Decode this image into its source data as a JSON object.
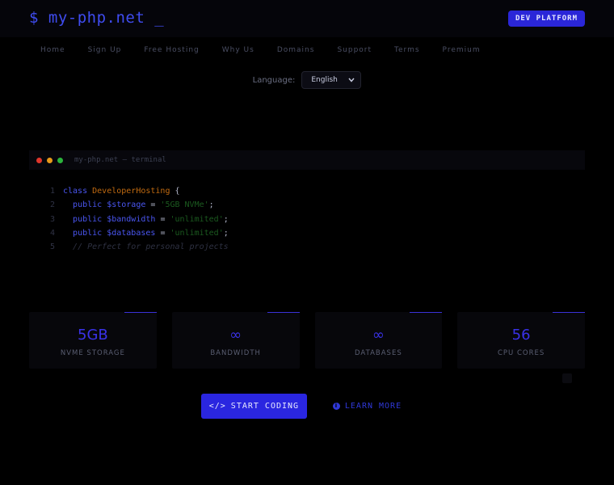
{
  "header": {
    "logo": "$ my-php.net _",
    "badge": "DEV PLATFORM"
  },
  "nav": {
    "items": [
      "Home",
      "Sign Up",
      "Free Hosting",
      "Why Us",
      "Domains",
      "Support",
      "Terms",
      "Premium"
    ]
  },
  "language": {
    "label": "Language:",
    "selected": "English"
  },
  "terminal": {
    "title": "my-php.net — terminal",
    "dots": [
      "#e0362c",
      "#e89a1a",
      "#2bb43c"
    ],
    "lines": [
      {
        "num": "1",
        "kw": "class",
        "name": "DeveloperHosting",
        "rest": " {"
      },
      {
        "num": "2",
        "kw": "public",
        "var": "$storage",
        "eq": " = ",
        "str": "'5GB NVMe'",
        "end": ";"
      },
      {
        "num": "3",
        "kw": "public",
        "var": "$bandwidth",
        "eq": " = ",
        "str": "'unlimited'",
        "end": ";"
      },
      {
        "num": "4",
        "kw": "public",
        "var": "$databases",
        "eq": " = ",
        "str": "'unlimited'",
        "end": ";"
      },
      {
        "num": "5",
        "comment": "// Perfect for personal projects"
      }
    ]
  },
  "stats": [
    {
      "value": "5GB",
      "label": "NVME STORAGE"
    },
    {
      "value": "∞",
      "label": "BANDWIDTH"
    },
    {
      "value": "∞",
      "label": "DATABASES"
    },
    {
      "value": "56",
      "label": "CPU CORES"
    }
  ],
  "cta": {
    "primary_icon": "</>",
    "primary": "START CODING",
    "secondary_icon": "i",
    "secondary": "LEARN MORE"
  },
  "colors": {
    "accent": "#2a26e0",
    "background": "#000000"
  }
}
